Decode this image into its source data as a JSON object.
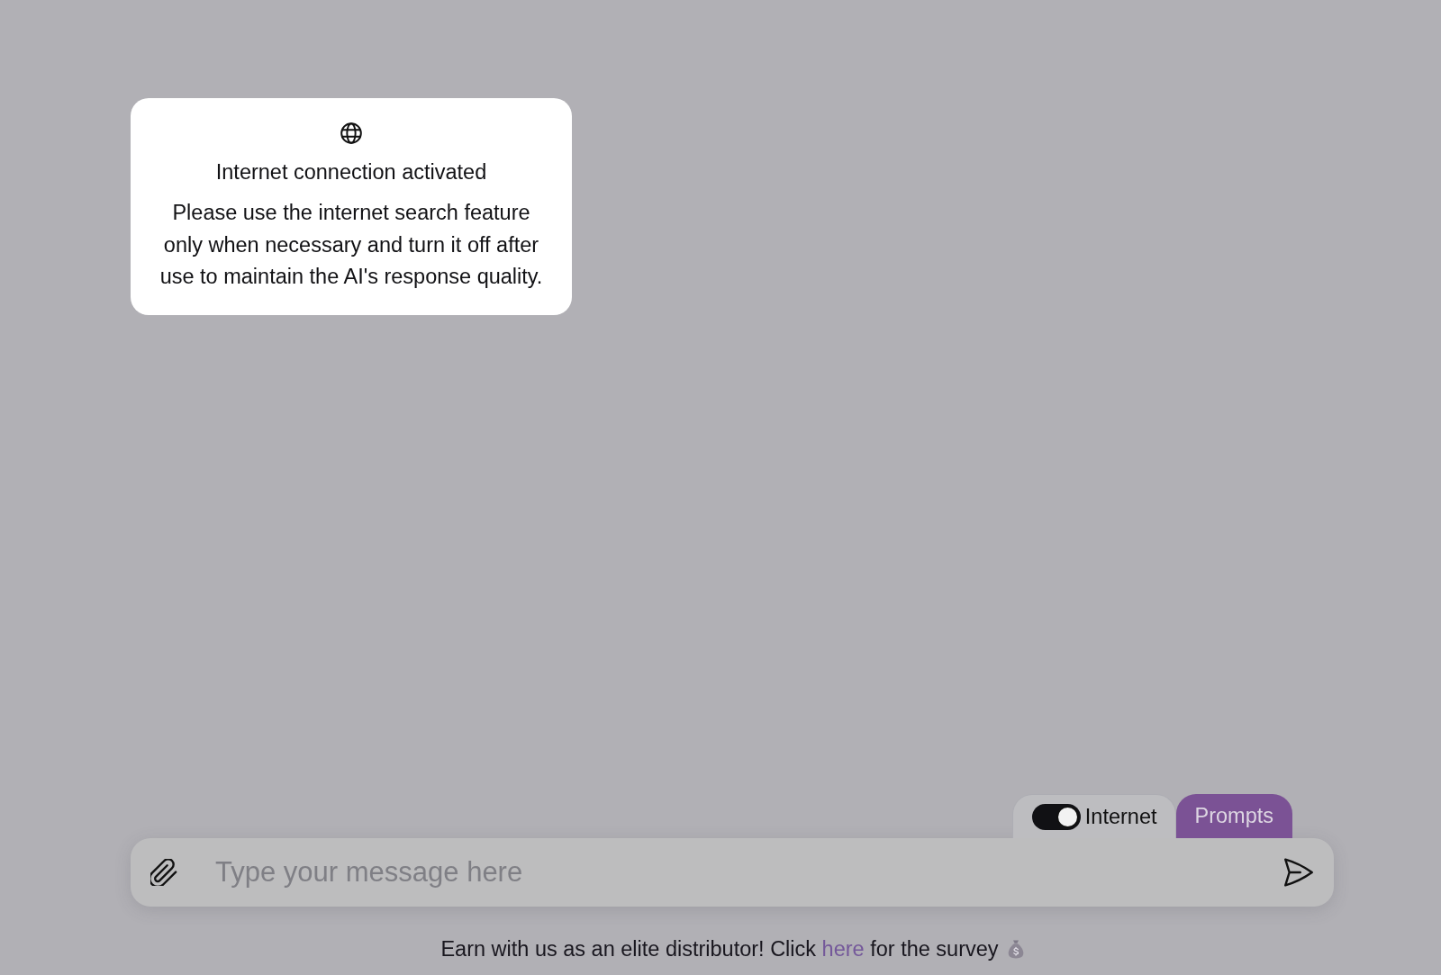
{
  "notice": {
    "title": "Internet connection activated",
    "message": "Please use the internet search feature only when necessary and turn it off after use to maintain the AI's response quality."
  },
  "composer": {
    "internet_toggle": {
      "label": "Internet",
      "on": true
    },
    "prompts_button": {
      "label": "Prompts"
    },
    "message_field": {
      "placeholder": "Type your message here"
    }
  },
  "footer": {
    "text_before": "Earn with us as an elite distributor! Click ",
    "link": "here",
    "text_after": " for the survey"
  }
}
